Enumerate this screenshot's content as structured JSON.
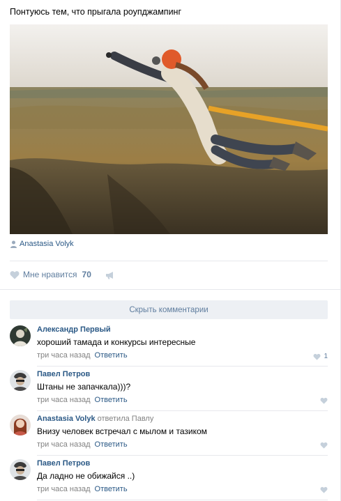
{
  "post": {
    "text": "Понтуюсь тем, что прыгала роупджампинг",
    "author": "Anastasia Volyk",
    "likes_label": "Мне нравится",
    "likes_count": "70"
  },
  "icons": {
    "author": "person-icon",
    "likes": "heart-icon",
    "share": "megaphone-icon"
  },
  "colors": {
    "link": "#2a5885",
    "muted": "#828282",
    "action": "#5f7d9e",
    "button_bg": "#edf0f4"
  },
  "comments_toggle": "Скрыть комментарии",
  "comments": [
    {
      "name": "Александр Первый",
      "reply_note": "",
      "reply_target": "",
      "text": "хороший тамада и конкурсы интересные",
      "time": "три часа назад",
      "reply_label": "Ответить",
      "likes": "1"
    },
    {
      "name": "Павел Петров",
      "reply_note": "",
      "reply_target": "",
      "text": "Штаны не запачкала)))?",
      "time": "три часа назад",
      "reply_label": "Ответить",
      "likes": ""
    },
    {
      "name": "Anastasia Volyk",
      "reply_note": "ответила",
      "reply_target": "Павлу",
      "text": "Внизу человек встречал с мылом и тазиком",
      "time": "три часа назад",
      "reply_label": "Ответить",
      "likes": ""
    },
    {
      "name": "Павел Петров",
      "reply_note": "",
      "reply_target": "",
      "text": "Да ладно не обижайся ..)",
      "time": "три часа назад",
      "reply_label": "Ответить",
      "likes": ""
    }
  ]
}
